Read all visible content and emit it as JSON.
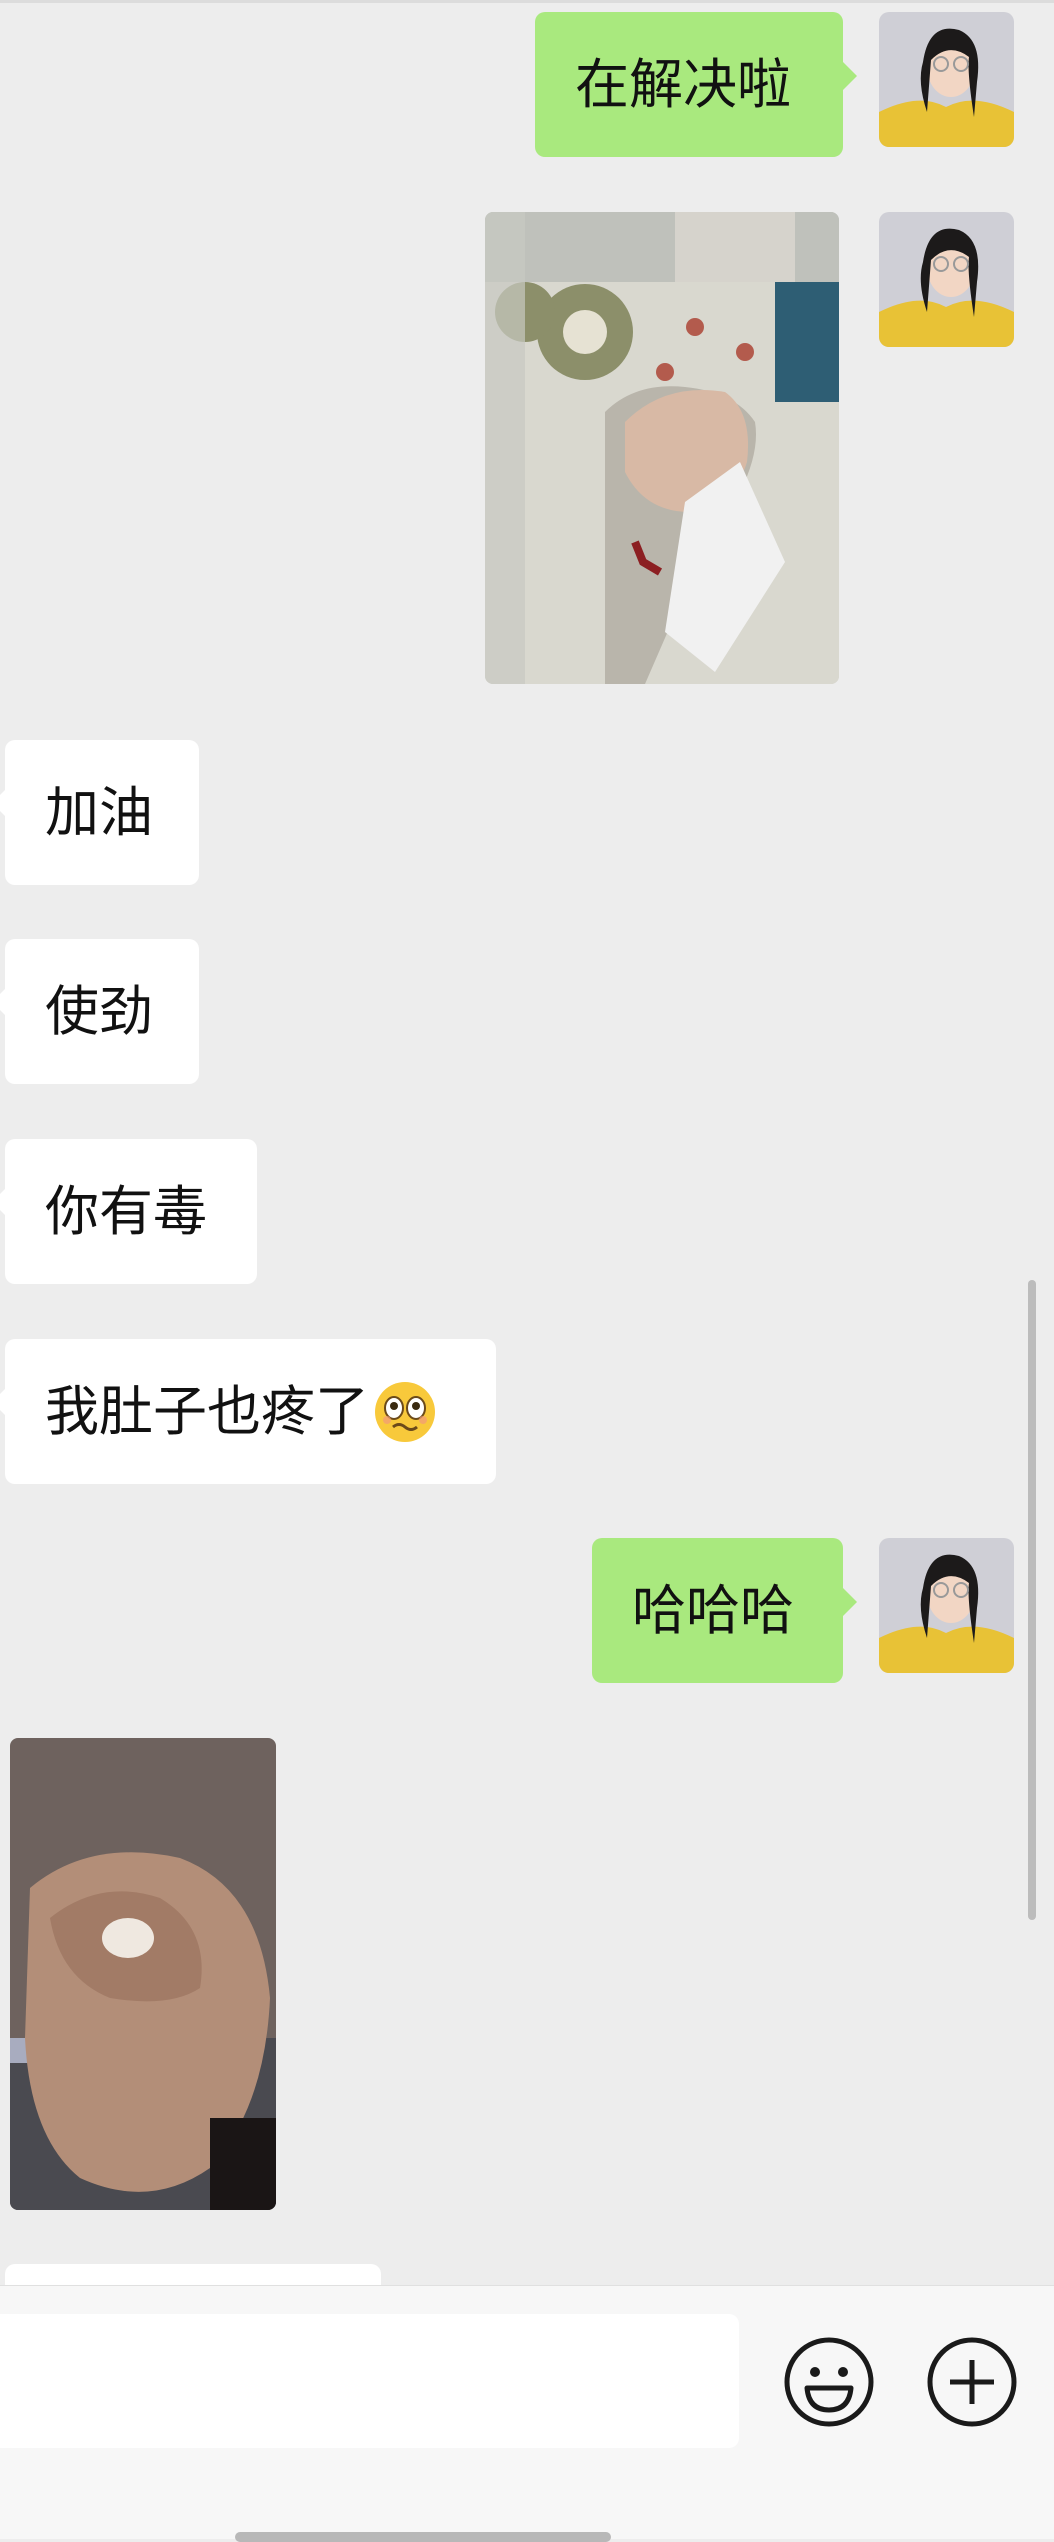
{
  "messages": [
    {
      "id": 1,
      "side": "out",
      "type": "text",
      "text": "在解决啦"
    },
    {
      "id": 2,
      "side": "out",
      "type": "image",
      "content": "photo of a fist holding a tissue"
    },
    {
      "id": 3,
      "side": "in",
      "type": "text",
      "text": "加油"
    },
    {
      "id": 4,
      "side": "in",
      "type": "text",
      "text": "使劲"
    },
    {
      "id": 5,
      "side": "in",
      "type": "text",
      "text": "你有毒"
    },
    {
      "id": 6,
      "side": "in",
      "type": "text",
      "text": "我肚子也疼了",
      "emoji": "woozy-face-emoji"
    },
    {
      "id": 7,
      "side": "out",
      "type": "text",
      "text": "哈哈哈"
    },
    {
      "id": 8,
      "side": "in",
      "type": "image",
      "content": "photo of a clenched fist"
    }
  ],
  "input": {
    "value": "",
    "placeholder": ""
  },
  "icons": {
    "emoji_button": "smiley-face-icon",
    "more_button": "plus-circle-icon"
  },
  "colors": {
    "background": "#ededed",
    "outgoing_bubble": "#a9e97e",
    "incoming_bubble": "#ffffff",
    "text": "#111111"
  }
}
